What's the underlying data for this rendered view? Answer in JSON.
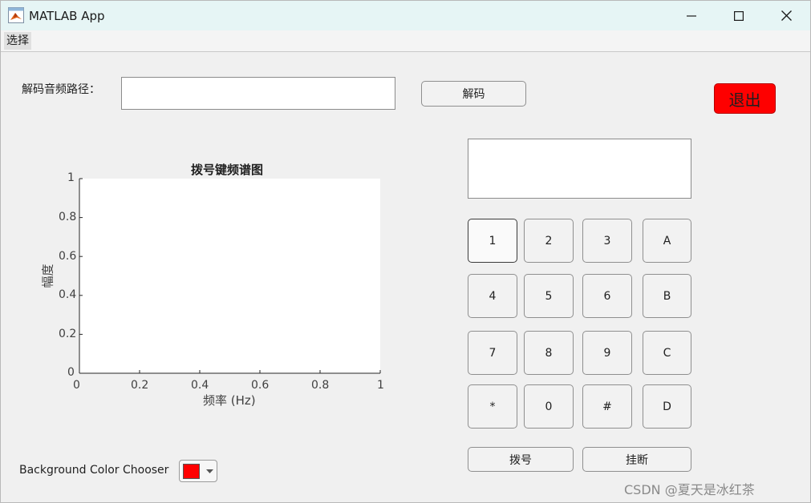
{
  "window": {
    "title": "MATLAB App"
  },
  "menu": {
    "items": [
      "选择"
    ]
  },
  "decode": {
    "path_label": "解码音频路径：",
    "path_value": "",
    "button_label": "解码"
  },
  "exit_button_label": "退出",
  "display": {
    "value": ""
  },
  "chart": {
    "title": "拨号键频谱图",
    "xlabel": "频率 (Hz)",
    "ylabel": "幅度",
    "xticks": [
      "0",
      "0.2",
      "0.4",
      "0.6",
      "0.8",
      "1"
    ],
    "yticks": [
      "0",
      "0.2",
      "0.4",
      "0.6",
      "0.8",
      "1"
    ]
  },
  "chart_data": {
    "type": "line",
    "title": "拨号键频谱图",
    "xlabel": "频率 (Hz)",
    "ylabel": "幅度",
    "xlim": [
      0,
      1
    ],
    "ylim": [
      0,
      1
    ],
    "series": [],
    "grid": false
  },
  "keypad": {
    "keys": [
      "1",
      "2",
      "3",
      "A",
      "4",
      "5",
      "6",
      "B",
      "7",
      "8",
      "9",
      "C",
      "*",
      "0",
      "#",
      "D"
    ],
    "dial_label": "拨号",
    "hangup_label": "挂断"
  },
  "background_color": {
    "label": "Background Color Chooser",
    "value": "#ff0000"
  },
  "watermark": "CSDN @夏天是冰红茶"
}
